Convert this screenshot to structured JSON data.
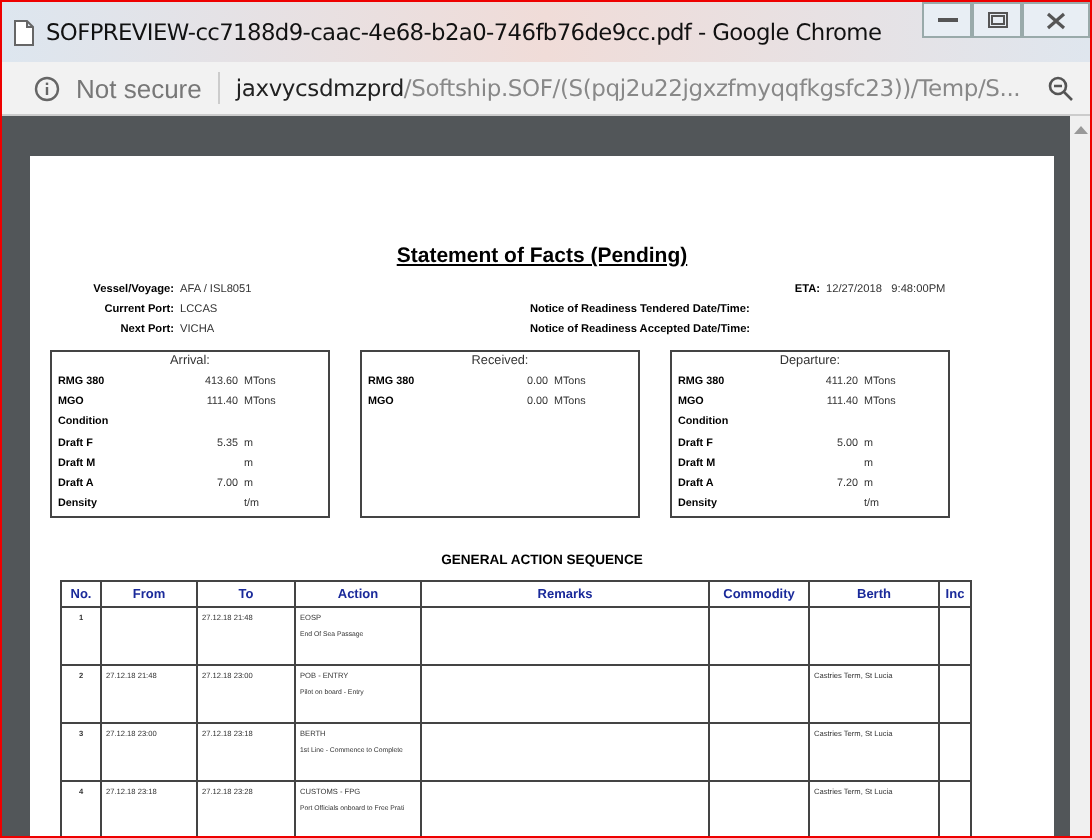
{
  "window": {
    "title": "SOFPREVIEW-cc7188d9-caac-4e68-b2a0-746fb76de9cc.pdf - Google Chrome"
  },
  "address_bar": {
    "security": "Not secure",
    "host": "jaxvycsdmzprd",
    "path": "/Softship.SOF/(S(pqj2u22jgxzfmyqqfkgsfc23))/Temp/S..."
  },
  "document": {
    "title": "Statement of Facts (Pending)",
    "left_fields": [
      {
        "label": "Vessel/Voyage:",
        "value": "AFA / ISL8051"
      },
      {
        "label": "Current Port:",
        "value": "LCCAS"
      },
      {
        "label": "Next Port:",
        "value": "VICHA"
      }
    ],
    "right_fields": [
      {
        "label": "ETA:",
        "value": "12/27/2018   9:48:00PM"
      },
      {
        "label": "Notice of Readiness Tendered Date/Time:"
      },
      {
        "label": "Notice of Readiness Accepted Date/Time:"
      }
    ],
    "panels": [
      {
        "title": "Arrival:",
        "rows": [
          {
            "label": "RMG 380",
            "value": "413.60",
            "unit": "MTons"
          },
          {
            "label": "MGO",
            "value": "111.40",
            "unit": "MTons"
          },
          {
            "label": "Condition"
          },
          {
            "label": "Draft F",
            "value": "5.35",
            "unit": "m"
          },
          {
            "label": "Draft M",
            "unit": "m"
          },
          {
            "label": "Draft A",
            "value": "7.00",
            "unit": "m"
          },
          {
            "label": "Density",
            "unit": "t/m"
          }
        ]
      },
      {
        "title": "Received:",
        "rows": [
          {
            "label": "RMG 380",
            "value": "0.00",
            "unit": "MTons"
          },
          {
            "label": "MGO",
            "value": "0.00",
            "unit": "MTons"
          }
        ]
      },
      {
        "title": "Departure:",
        "rows": [
          {
            "label": "RMG 380",
            "value": "411.20",
            "unit": "MTons"
          },
          {
            "label": "MGO",
            "value": "111.40",
            "unit": "MTons"
          },
          {
            "label": "Condition"
          },
          {
            "label": "Draft F",
            "value": "5.00",
            "unit": "m"
          },
          {
            "label": "Draft M",
            "unit": "m"
          },
          {
            "label": "Draft A",
            "value": "7.20",
            "unit": "m"
          },
          {
            "label": "Density",
            "unit": "t/m"
          }
        ]
      }
    ],
    "section_title": "GENERAL ACTION SEQUENCE",
    "table": {
      "columns": [
        "No.",
        "From",
        "To",
        "Action",
        "Remarks",
        "Commodity",
        "Berth",
        "Inc"
      ],
      "rows": [
        {
          "no": "1",
          "to": "27.12.18  21:48",
          "action": "EOSP",
          "action_detail": "End Of Sea Passage"
        },
        {
          "no": "2",
          "from": "27.12.18  21:48",
          "to": "27.12.18  23:00",
          "action": "POB - ENTRY",
          "action_detail": "Pilot on board - Entry",
          "berth": "Castries Term, St Lucia"
        },
        {
          "no": "3",
          "from": "27.12.18  23:00",
          "to": "27.12.18  23:18",
          "action": "BERTH",
          "action_detail": "1st Line - Commence to Complete",
          "berth": "Castries Term, St Lucia"
        },
        {
          "no": "4",
          "from": "27.12.18  23:18",
          "to": "27.12.18  23:28",
          "action": "CUSTOMS - FPG",
          "action_detail": "Port Officials onboard to Free Prati",
          "berth": "Castries Term, St Lucia"
        }
      ]
    }
  }
}
